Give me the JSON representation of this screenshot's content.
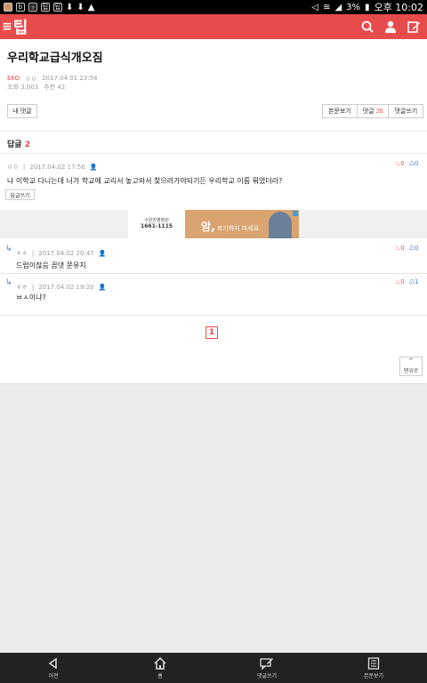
{
  "status_bar": {
    "battery": "3%",
    "time": "오후 10:02"
  },
  "header": {
    "logo_text": "팁"
  },
  "post": {
    "title": "우리학교급식개오짐",
    "author": "EKO",
    "author_sub": "ㅇㅇ",
    "date": "2017.04.01 23:54",
    "views": "조회 3,003",
    "likes": "추천 42"
  },
  "toolbar": {
    "my_comment": "내 댓글",
    "view_post": "본문보기",
    "comments_label": "댓글",
    "comments_count": "26",
    "write_comment": "댓글쓰기"
  },
  "replies": {
    "label": "답글",
    "count": "2"
  },
  "comments": [
    {
      "author": "ㅇㅇ",
      "date": "2017.04.02 17:56",
      "text": "나 이학교 다니는데 너가 학교에 교리서 놓고와서 찾으러가야되기든 우리학교 이름 뭐였더라?",
      "up": "0",
      "down": "0",
      "reply_label": "답글쓰기"
    },
    {
      "author": "ㅎㅎ",
      "date": "2017.04.02 20:47",
      "text": "드럽이잖음 꼽댓 쭌유치",
      "up": "0",
      "down": "0"
    },
    {
      "author": "ㅎㅎ",
      "date": "2017.04.02 19:20",
      "text": "ㅂㅅ이냐?",
      "up": "0",
      "down": "1"
    }
  ],
  "ad": {
    "left_brand": "수원한병병원",
    "left_phone": "1661-1115",
    "right_big": "암,",
    "right_text": "포기하지 마세요."
  },
  "pagination": {
    "current": "1"
  },
  "top_button": {
    "label": "맨위로"
  },
  "bottom_nav": [
    {
      "label": "이전",
      "icon": "back-icon"
    },
    {
      "label": "홈",
      "icon": "home-icon"
    },
    {
      "label": "댓글쓰기",
      "icon": "write-comment-icon"
    },
    {
      "label": "본문보기",
      "icon": "document-icon"
    }
  ]
}
